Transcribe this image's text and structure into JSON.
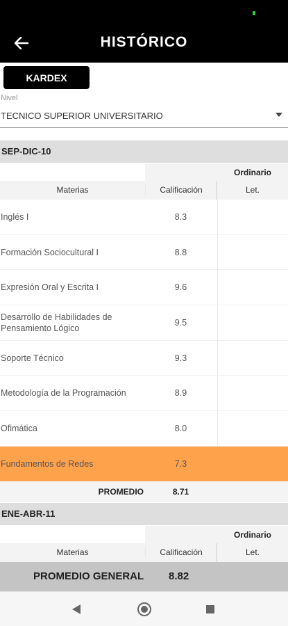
{
  "header": {
    "title": "HISTÓRICO",
    "back_icon": "arrow-left-icon"
  },
  "kardex_button": "KARDEX",
  "nivel": {
    "label": "Nivel",
    "value": "TECNICO SUPERIOR UNIVERSITARIO"
  },
  "table_headers": {
    "ordinario": "Ordinario",
    "materias": "Materias",
    "calificacion": "Calificación",
    "let": "Let."
  },
  "periods": [
    {
      "name": "SEP-DIC-10",
      "rows": [
        {
          "subject": "Inglés I",
          "grade": "8.3"
        },
        {
          "subject": "Formación Sociocultural I",
          "grade": "8.8"
        },
        {
          "subject": "Expresión Oral y Escrita I",
          "grade": "9.6"
        },
        {
          "subject": "Desarrollo de Habilidades de Pensamiento Lógico",
          "grade": "9.5"
        },
        {
          "subject": "Soporte Técnico",
          "grade": "9.3"
        },
        {
          "subject": "Metodología de la Programación",
          "grade": "8.9"
        },
        {
          "subject": "Ofimática",
          "grade": "8.0"
        },
        {
          "subject": "Fundamentos de Redes",
          "grade": "7.3",
          "highlight": true
        }
      ],
      "promedio_label": "PROMEDIO",
      "promedio_value": "8.71"
    },
    {
      "name": "ENE-ABR-11"
    }
  ],
  "promedio_general": {
    "label": "PROMEDIO GENERAL",
    "value": "8.82"
  },
  "colors": {
    "highlight": "#ffa24c",
    "app_bar": "#000000",
    "period_header": "#dedede"
  },
  "nav_icons": [
    "nav-back-icon",
    "nav-home-icon",
    "nav-recents-icon"
  ]
}
